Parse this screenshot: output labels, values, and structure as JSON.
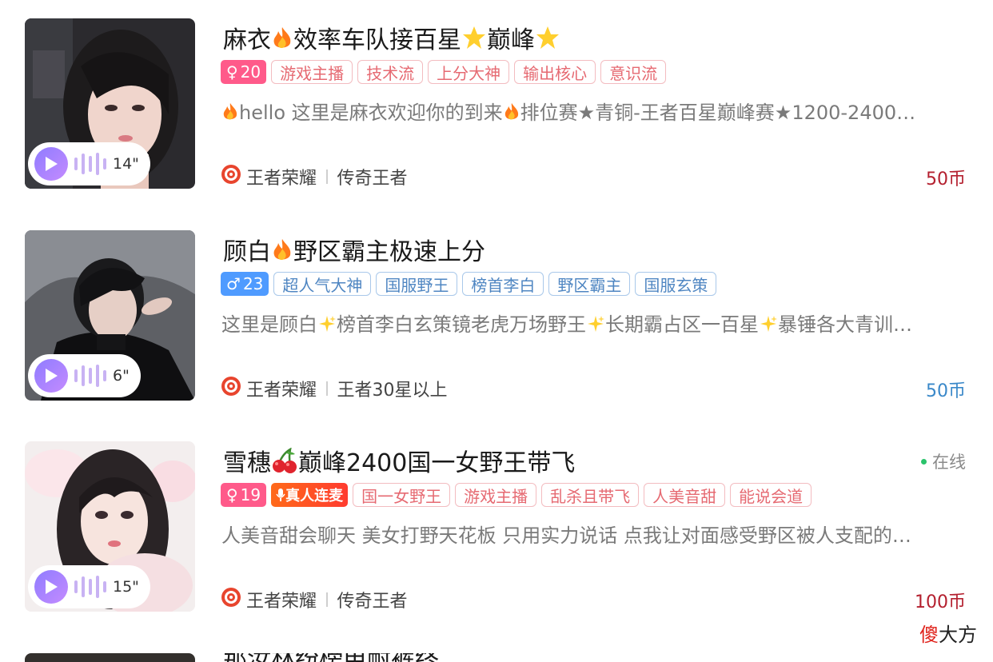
{
  "cards": [
    {
      "title_a": "麻衣",
      "title_b": "效率车队接百星",
      "title_c": "巅峰",
      "badge_symbol": "♀",
      "badge_age": "20",
      "tags": [
        "游戏主播",
        "技术流",
        "上分大神",
        "输出核心",
        "意识流"
      ],
      "desc_a": "hello 这里是麻衣欢迎你的到来",
      "desc_b": "排位赛★青铜-王者百星巅峰赛★1200-2400…",
      "voice_duration": "14\"",
      "game": "王者荣耀",
      "rank": "传奇王者",
      "price": "50币",
      "price_color": "#b4202f"
    },
    {
      "title_a": "顾白",
      "title_b": "野区霸主极速上分",
      "badge_symbol": "♂",
      "badge_age": "23",
      "tags": [
        "超人气大神",
        "国服野王",
        "榜首李白",
        "野区霸主",
        "国服玄策"
      ],
      "desc_a": "这里是顾白",
      "desc_b": "榜首李白玄策镜老虎万场野王",
      "desc_c": "长期霸占区一百星",
      "desc_d": "暴锤各大青训…",
      "voice_duration": "6\"",
      "game": "王者荣耀",
      "rank": "王者30星以上",
      "price": "50币",
      "price_color": "#3a88c9"
    },
    {
      "title_a": "雪穗",
      "title_b": "巅峰2400国一女野王带飞",
      "status": "在线",
      "badge_symbol": "♀",
      "badge_age": "19",
      "real_badge": "真人连麦",
      "tags": [
        "国一女野王",
        "游戏主播",
        "乱杀且带飞",
        "人美音甜",
        "能说会道"
      ],
      "desc": "人美音甜会聊天 美女打野天花板 只用实力说话 点我让对面感受野区被人支配的…",
      "voice_duration": "15\"",
      "game": "王者荣耀",
      "rank": "传奇王者",
      "price": "100币",
      "price_color": "#b4202f"
    }
  ],
  "partial_title": "那汝林纷榜电耐裤终",
  "watermark_a": "傻",
  "watermark_b": "大方"
}
